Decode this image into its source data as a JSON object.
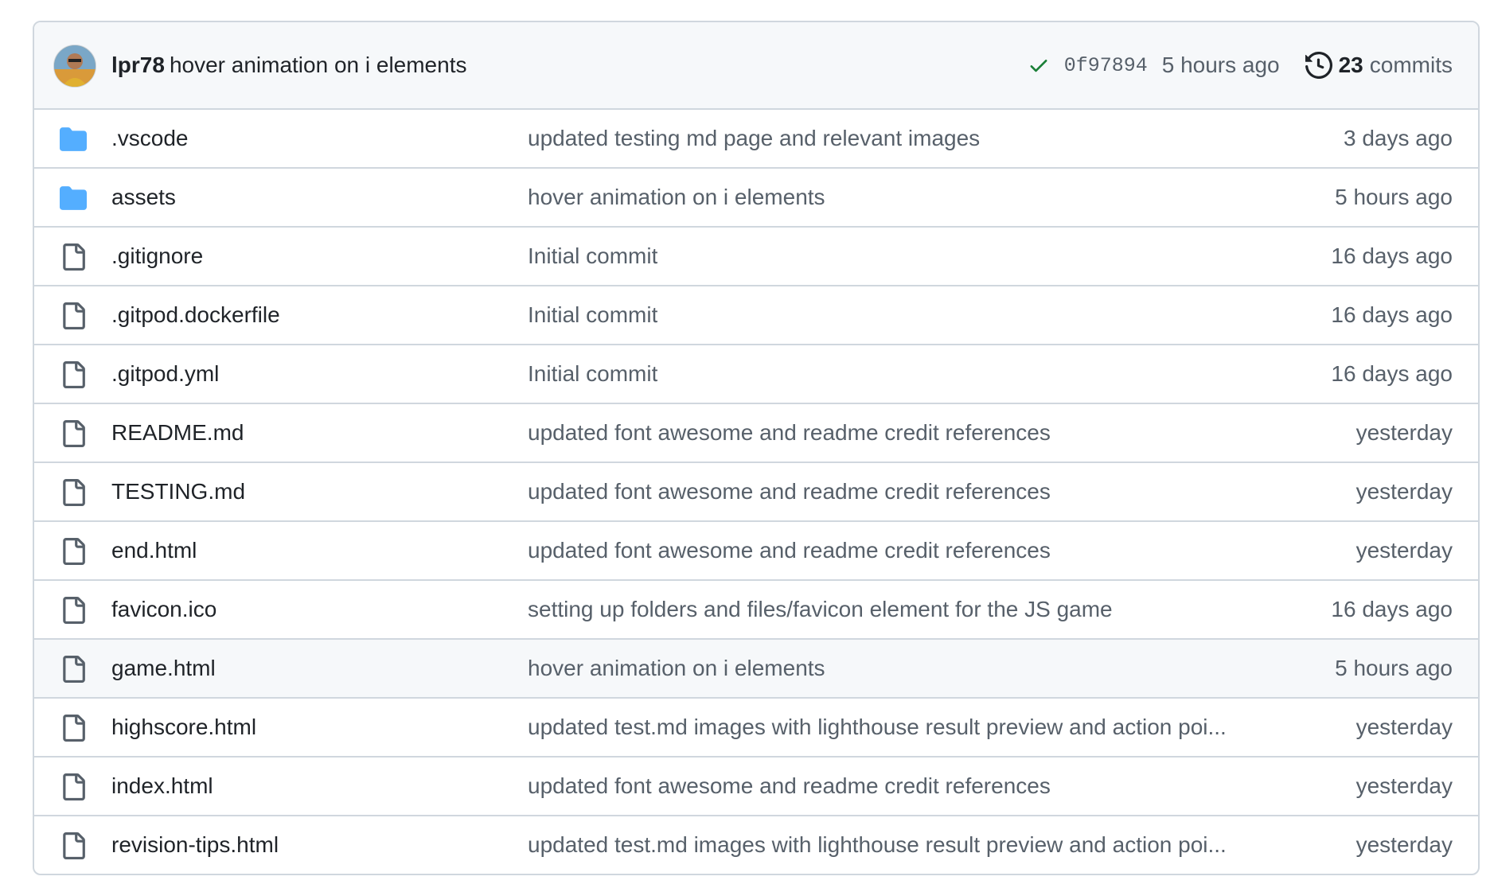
{
  "header": {
    "author": "lpr78",
    "message": "hover animation on i elements",
    "sha": "0f97894",
    "time": "5 hours ago",
    "commit_count": "23",
    "commit_label": "commits",
    "check_color": "#1a7f37"
  },
  "files": [
    {
      "type": "folder",
      "icon": "folder-icon",
      "name": ".vscode",
      "message": "updated testing md page and relevant images",
      "age": "3 days ago"
    },
    {
      "type": "folder",
      "icon": "folder-icon",
      "name": "assets",
      "message": "hover animation on i elements",
      "age": "5 hours ago"
    },
    {
      "type": "file",
      "icon": "file-icon",
      "name": ".gitignore",
      "message": "Initial commit",
      "age": "16 days ago"
    },
    {
      "type": "file",
      "icon": "file-icon",
      "name": ".gitpod.dockerfile",
      "message": "Initial commit",
      "age": "16 days ago"
    },
    {
      "type": "file",
      "icon": "file-icon",
      "name": ".gitpod.yml",
      "message": "Initial commit",
      "age": "16 days ago"
    },
    {
      "type": "file",
      "icon": "file-icon",
      "name": "README.md",
      "message": "updated font awesome and readme credit references",
      "age": "yesterday"
    },
    {
      "type": "file",
      "icon": "file-icon",
      "name": "TESTING.md",
      "message": "updated font awesome and readme credit references",
      "age": "yesterday"
    },
    {
      "type": "file",
      "icon": "file-icon",
      "name": "end.html",
      "message": "updated font awesome and readme credit references",
      "age": "yesterday"
    },
    {
      "type": "file",
      "icon": "file-icon",
      "name": "favicon.ico",
      "message": "setting up folders and files/favicon element for the JS game",
      "age": "16 days ago"
    },
    {
      "type": "file",
      "icon": "file-icon",
      "name": "game.html",
      "message": "hover animation on i elements",
      "age": "5 hours ago",
      "hover": true
    },
    {
      "type": "file",
      "icon": "file-icon",
      "name": "highscore.html",
      "message": "updated test.md images with lighthouse result preview and action poi...",
      "age": "yesterday"
    },
    {
      "type": "file",
      "icon": "file-icon",
      "name": "index.html",
      "message": "updated font awesome and readme credit references",
      "age": "yesterday"
    },
    {
      "type": "file",
      "icon": "file-icon",
      "name": "revision-tips.html",
      "message": "updated test.md images with lighthouse result preview and action poi...",
      "age": "yesterday"
    }
  ],
  "colors": {
    "folder": "#54aeff",
    "file_icon": "#57606a",
    "border": "#d0d7de",
    "header_bg": "#f6f8fa"
  }
}
